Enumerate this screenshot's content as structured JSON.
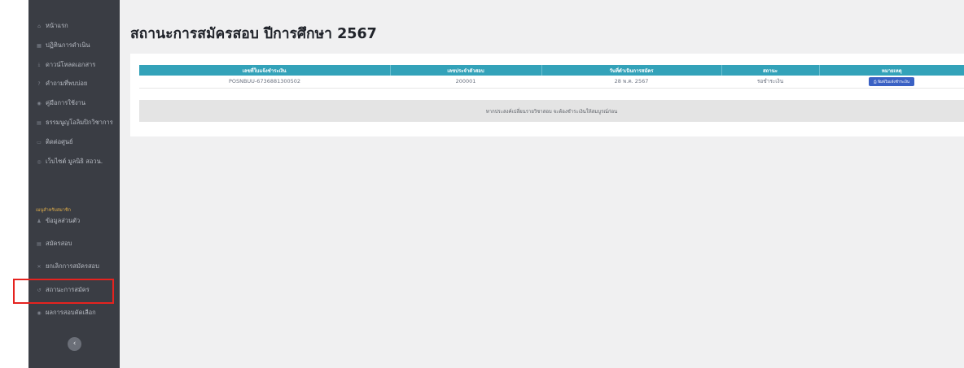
{
  "sidebar": {
    "items": [
      {
        "label": "หน้าแรก",
        "icon": "home-icon",
        "glyph": "⌂"
      },
      {
        "label": "ปฏิทินการดำเนิน",
        "icon": "calendar-icon",
        "glyph": "▦"
      },
      {
        "label": "ดาวน์โหลดเอกสาร",
        "icon": "download-icon",
        "glyph": "⤓"
      },
      {
        "label": "คำถามที่พบบ่อย",
        "icon": "question-icon",
        "glyph": "?"
      },
      {
        "label": "คู่มือการใช้งาน",
        "icon": "book-icon",
        "glyph": "◉"
      },
      {
        "label": "ธรรมนูญโอลิมปิกวิชาการ",
        "icon": "document-icon",
        "glyph": "▤"
      },
      {
        "label": "ติดต่อศูนย์",
        "icon": "contact-icon",
        "glyph": "▭"
      },
      {
        "label": "เว็บไซต์ มูลนิธิ สอวน.",
        "icon": "globe-icon",
        "glyph": "◎"
      }
    ],
    "section_title": "เมนูสำหรับสมาชิก",
    "member_items": [
      {
        "label": "ข้อมูลส่วนตัว",
        "icon": "user-icon",
        "glyph": "♟"
      },
      {
        "label": "สมัครสอบ",
        "icon": "form-icon",
        "glyph": "▤"
      },
      {
        "label": "ยกเลิกการสมัครสอบ",
        "icon": "cancel-icon",
        "glyph": "✕"
      },
      {
        "label": "สถานะการสมัคร",
        "icon": "history-icon",
        "glyph": "↺"
      },
      {
        "label": "ผลการสอบคัดเลือก",
        "icon": "result-icon",
        "glyph": "◉"
      }
    ],
    "toggle_glyph": "‹"
  },
  "main": {
    "title": "สถานะการสมัครสอบ ปีการศึกษา 2567",
    "table": {
      "headers": [
        "เลขที่ใบแจ้งชำระเงิน",
        "เลขประจำตัวสอบ",
        "วันที่ดำเนินการสมัคร",
        "สถานะ",
        "หมายเหตุ"
      ],
      "rows": [
        {
          "invoice": "POSNBUU-6736881300502",
          "exam_id": "200001",
          "date": "28 พ.ค. 2567",
          "status": "รอชำระเงิน",
          "button": "พิมพ์ใบแจ้งชำระเงิน"
        }
      ]
    },
    "notice": "หากประสงค์เปลี่ยนรายวิชาสอบ จะต้องชำระเงินให้สมบูรณ์ก่อน"
  },
  "colors": {
    "sidebar_bg": "#3a3d44",
    "header_accent": "#33a2b9",
    "button_blue": "#3a61c4",
    "highlight_red": "#e5231f"
  }
}
